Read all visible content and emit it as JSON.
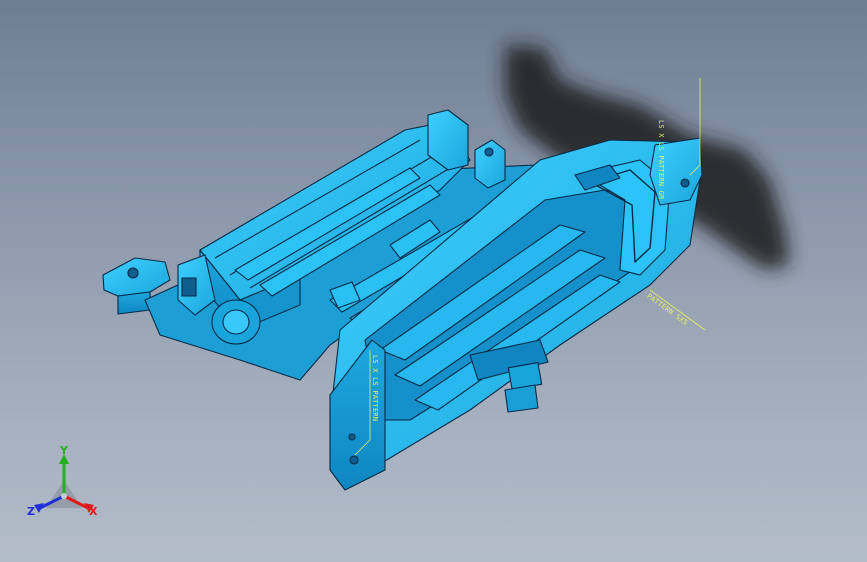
{
  "viewport": {
    "background_top": "#6f7d92",
    "background_bottom": "#b3bcc8"
  },
  "model": {
    "name": "",
    "body_color": "#22b8ee",
    "edge_color": "#062a46",
    "shadow_color": "#222222"
  },
  "annotations": [
    {
      "id": "annot-right-top",
      "text": "LS X LS PATTERN GR"
    },
    {
      "id": "annot-right-mid",
      "text": "PATTERN 5X5"
    },
    {
      "id": "annot-left",
      "text": "LS X LS PATTERN"
    }
  ],
  "triad": {
    "x_label": "X",
    "y_label": "Y",
    "z_label": "Z",
    "x_color": "#e01818",
    "y_color": "#22b022",
    "z_color": "#2030d8"
  }
}
